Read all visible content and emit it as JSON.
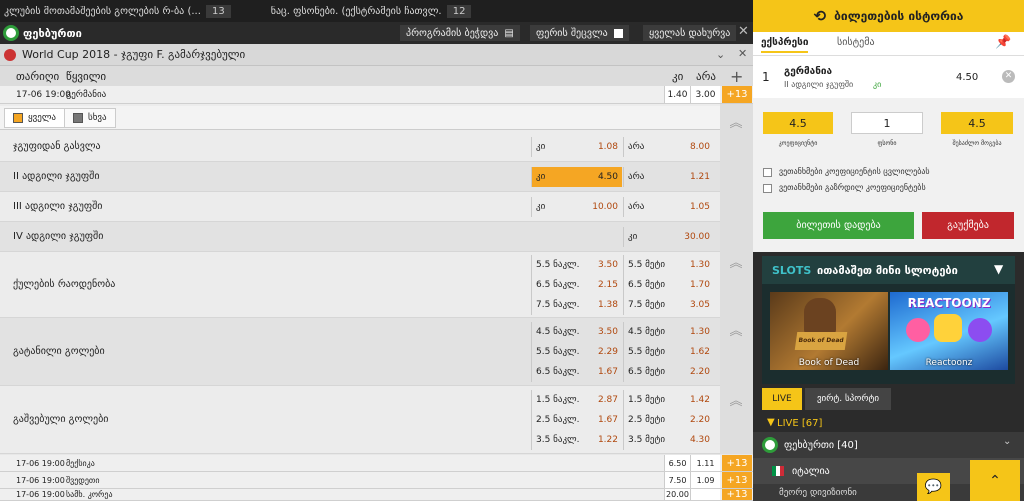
{
  "top_strip": {
    "left_text": "კლუბის მოთამაშეების გოლების რ-ბა (...",
    "left_count": "13",
    "mid_text": "ნაც. ფსონები. (ექსტრამეის ჩათვლ...",
    "mid_count": "12"
  },
  "sport_bar": {
    "sport": "ფეხბურთი",
    "print_label": "პროგრამის ბეჭდვა",
    "odds_label": "ფერის შეცვლა",
    "all_label": "ყველას დახურვა"
  },
  "event_header": {
    "title": "World Cup 2018 - ჯგუფი F. გამარჯვებული"
  },
  "columns": {
    "date": "თარიღი",
    "event": "წყვილი",
    "yes": "კი",
    "no": "არა"
  },
  "event_row": {
    "date": "17-06 19:00",
    "name": "გერმანია",
    "yes": "1.40",
    "no": "3.00",
    "more": "+13"
  },
  "filter_tabs": {
    "all": "ყველა",
    "other": "სხვა"
  },
  "markets": [
    {
      "name": "ჯგუფიდან გასვლა",
      "k1": "კი",
      "v1": "1.08",
      "k2": "არა",
      "v2": "8.00"
    },
    {
      "name": "II ადგილი ჯგუფში",
      "k1": "კი",
      "v1": "4.50",
      "k2": "არა",
      "v2": "1.21"
    },
    {
      "name": "III ადგილი ჯგუფში",
      "k1": "კი",
      "v1": "10.00",
      "k2": "არა",
      "v2": "1.05"
    },
    {
      "name": "IV ადგილი ჯგუფში",
      "k2": "კი",
      "v2": "30.00"
    }
  ],
  "multi_markets": [
    {
      "name": "ქულების რაოდენობა",
      "rows": [
        {
          "k1": "5.5 ნაკლ.",
          "v1": "3.50",
          "k2": "5.5 მეტი",
          "v2": "1.30"
        },
        {
          "k1": "6.5 ნაკლ.",
          "v1": "2.15",
          "k2": "6.5 მეტი",
          "v2": "1.70"
        },
        {
          "k1": "7.5 ნაკლ.",
          "v1": "1.38",
          "k2": "7.5 მეტი",
          "v2": "3.05"
        }
      ]
    },
    {
      "name": "გატანილი გოლები",
      "rows": [
        {
          "k1": "4.5 ნაკლ.",
          "v1": "3.50",
          "k2": "4.5 მეტი",
          "v2": "1.30"
        },
        {
          "k1": "5.5 ნაკლ.",
          "v1": "2.29",
          "k2": "5.5 მეტი",
          "v2": "1.62"
        },
        {
          "k1": "6.5 ნაკლ.",
          "v1": "1.67",
          "k2": "6.5 მეტი",
          "v2": "2.20"
        }
      ]
    },
    {
      "name": "გაშვებული გოლები",
      "rows": [
        {
          "k1": "1.5 ნაკლ.",
          "v1": "2.87",
          "k2": "1.5 მეტი",
          "v2": "1.42"
        },
        {
          "k1": "2.5 ნაკლ.",
          "v1": "1.67",
          "k2": "2.5 მეტი",
          "v2": "2.20"
        },
        {
          "k1": "3.5 ნაკლ.",
          "v1": "1.22",
          "k2": "3.5 მეტი",
          "v2": "4.30"
        }
      ]
    }
  ],
  "bottom_rows": [
    {
      "date": "17-06 19:00",
      "name": "მექსიკა",
      "yes": "6.50",
      "no": "1.11",
      "more": "+13"
    },
    {
      "date": "17-06 19:00",
      "name": "შვედეთი",
      "yes": "7.50",
      "no": "1.09",
      "more": "+13"
    },
    {
      "date": "17-06 19:00",
      "name": "სამხ. კორეა",
      "yes": "20.00",
      "no": "",
      "more": "+13"
    }
  ],
  "betslip": {
    "history_title": "ბილეთების ისტორია",
    "tab_express": "ექსპრესი",
    "tab_system": "სისტემა",
    "item_index": "1",
    "item_team": "გერმანია",
    "item_market": "II ადგილი ჯგუფში",
    "item_pick": "კი",
    "item_odd": "4.50",
    "coef_value": "4.5",
    "coef_label": "კოეფიციენტი",
    "stake_value": "1",
    "stake_label": "ფსონი",
    "win_value": "4.5",
    "win_label": "შესაძლო მოგება",
    "check1": "ვეთანხმები კოეფიციენტის ცვლილებას",
    "check2": "ვეთანხმები გაზრდილ კოეფიციენტებს",
    "place_label": "ბილეთის დადება",
    "cancel_label": "გაუქმება"
  },
  "slots": {
    "tag": "SLOTS",
    "title": "ითამაშეთ მინი სლოტები",
    "game1": "Book of Dead",
    "game2": "Reactoonz",
    "game2_logo": "REACTOONZ",
    "game1_art": "Book of Dead"
  },
  "live": {
    "tab_live": "LIVE",
    "tab_virtual": "ვირტ. სპორტი",
    "count_label": "LIVE [67]",
    "sport_label": "ფეხბურთი [40]",
    "country_label": "იტალია",
    "trunc_label": "მეორე დივიზიონი"
  },
  "colors": {
    "accent": "#f5c518",
    "orange": "#f5a623",
    "green": "#3da53d",
    "red": "#c1272d"
  }
}
